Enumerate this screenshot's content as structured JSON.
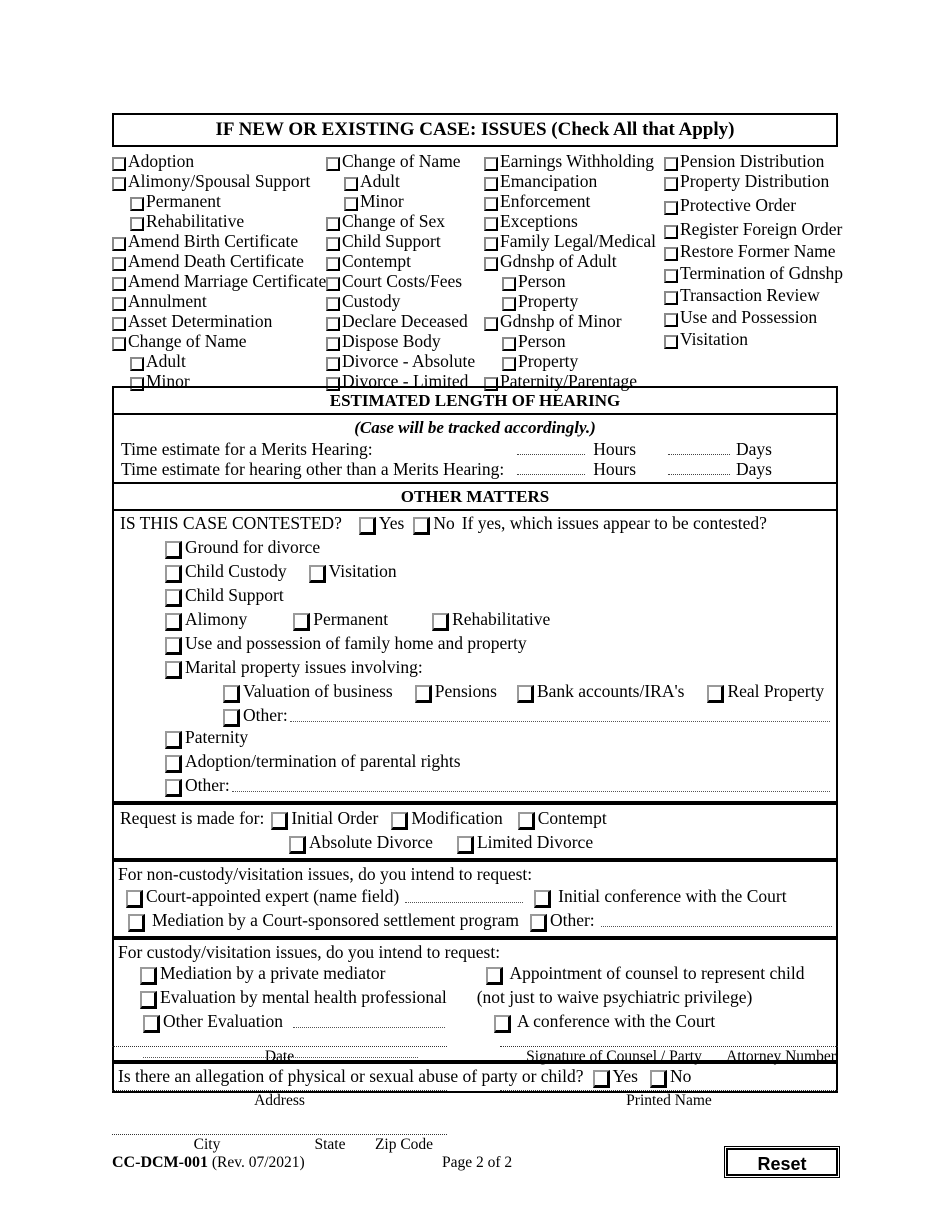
{
  "form": {
    "code": "CC-DCM-001",
    "revision": "(Rev. 07/2021)",
    "page_label": "Page 2 of 2",
    "reset_label": "Reset"
  },
  "issues_section": {
    "title": "IF NEW OR EXISTING CASE: ISSUES (Check All that Apply)",
    "columns": [
      {
        "items": [
          {
            "label": "Adoption",
            "indent": 0
          },
          {
            "label": "Alimony/Spousal Support",
            "indent": 0
          },
          {
            "label": "Permanent",
            "indent": 1
          },
          {
            "label": "Rehabilitative",
            "indent": 1
          },
          {
            "label": "Amend Birth Certificate",
            "indent": 0
          },
          {
            "label": "Amend Death Certificate",
            "indent": 0
          },
          {
            "label": "Amend Marriage Certificate",
            "indent": 0
          },
          {
            "label": "Annulment",
            "indent": 0
          },
          {
            "label": "Asset Determination",
            "indent": 0
          },
          {
            "label": "Change of Name",
            "indent": 0
          },
          {
            "label": "Adult",
            "indent": 1
          },
          {
            "label": "Minor",
            "indent": 1
          }
        ]
      },
      {
        "items": [
          {
            "label": "Change of Name",
            "indent": 0
          },
          {
            "label": "Adult",
            "indent": 1
          },
          {
            "label": "Minor",
            "indent": 1
          },
          {
            "label": "Change of Sex",
            "indent": 0
          },
          {
            "label": "Child Support",
            "indent": 0
          },
          {
            "label": "Contempt",
            "indent": 0
          },
          {
            "label": "Court Costs/Fees",
            "indent": 0
          },
          {
            "label": "Custody",
            "indent": 0
          },
          {
            "label": "Declare Deceased",
            "indent": 0
          },
          {
            "label": "Dispose Body",
            "indent": 0
          },
          {
            "label": "Divorce - Absolute",
            "indent": 0
          },
          {
            "label": "Divorce - Limited",
            "indent": 0
          }
        ]
      },
      {
        "items": [
          {
            "label": "Earnings Withholding",
            "indent": 0
          },
          {
            "label": "Emancipation",
            "indent": 0
          },
          {
            "label": "Enforcement",
            "indent": 0
          },
          {
            "label": "Exceptions",
            "indent": 0
          },
          {
            "label": "Family Legal/Medical",
            "indent": 0
          },
          {
            "label": "Gdnshp of Adult",
            "indent": 0
          },
          {
            "label": "Person",
            "indent": 1
          },
          {
            "label": "Property",
            "indent": 1
          },
          {
            "label": "Gdnshp of Minor",
            "indent": 0
          },
          {
            "label": "Person",
            "indent": 1
          },
          {
            "label": "Property",
            "indent": 1
          },
          {
            "label": "Paternity/Parentage",
            "indent": 0
          }
        ]
      },
      {
        "items": [
          {
            "label": "Pension Distribution",
            "indent": 0
          },
          {
            "label": "Property Distribution",
            "indent": 0
          },
          {
            "label": "Protective Order",
            "indent": 0
          },
          {
            "label": "Register Foreign Order",
            "indent": 0
          },
          {
            "label": "Restore Former Name",
            "indent": 0
          },
          {
            "label": "Termination of Gdnshp",
            "indent": 0
          },
          {
            "label": "Transaction Review",
            "indent": 0
          },
          {
            "label": "Use and Possession",
            "indent": 0
          },
          {
            "label": "Visitation",
            "indent": 0
          }
        ]
      }
    ]
  },
  "hearing_section": {
    "title": "ESTIMATED LENGTH OF HEARING",
    "note": "(Case will be tracked accordingly.)",
    "row1_label": "Time estimate for a Merits Hearing:",
    "row2_label": "Time estimate for hearing other than a Merits Hearing:",
    "hours_label": "Hours",
    "days_label": "Days",
    "row1_hours_value": "",
    "row1_days_value": "",
    "row2_hours_value": "",
    "row2_days_value": ""
  },
  "other_matters": {
    "title": "OTHER MATTERS",
    "contested_question": "IS THIS CASE CONTESTED?",
    "yes_label": "Yes",
    "no_label": "No",
    "contested_followup": "If yes, which issues appear to be contested?",
    "issues": {
      "ground_for_divorce": "Ground for divorce",
      "child_custody": "Child Custody",
      "visitation": "Visitation",
      "child_support": "Child Support",
      "alimony": "Alimony",
      "permanent": "Permanent",
      "rehabilitative": "Rehabilitative",
      "use_and_possession": "Use and possession of family home and property",
      "marital_property": "Marital property issues involving:",
      "valuation_of_business": "Valuation of business",
      "pensions": "Pensions",
      "bank_accounts": "Bank accounts/IRA's",
      "real_property": "Real Property",
      "other_marital": "Other:",
      "other_marital_value": "",
      "paternity": "Paternity",
      "adoption_termination": "Adoption/termination of parental rights",
      "other": "Other:",
      "other_value": ""
    }
  },
  "request_section": {
    "intro": "Request is made for:",
    "initial_order": "Initial Order",
    "modification": "Modification",
    "contempt": "Contempt",
    "absolute_divorce": "Absolute Divorce",
    "limited_divorce": "Limited Divorce"
  },
  "non_custody_section": {
    "intro": "For non-custody/visitation issues, do you intend to request:",
    "court_appointed_expert": "Court-appointed expert (name field)",
    "court_appointed_expert_value": "",
    "initial_conference": "Initial conference with the Court",
    "mediation_court_sponsored": "Mediation by a Court-sponsored settlement program",
    "other": "Other:",
    "other_value": ""
  },
  "custody_section": {
    "intro": "For custody/visitation issues, do you intend to request:",
    "private_mediator": "Mediation by a private mediator",
    "mental_health_evaluation": "Evaluation by mental health professional",
    "other_evaluation": "Other Evaluation",
    "other_evaluation_value": "",
    "other_evaluation_value2": "",
    "appointment_of_counsel": "Appointment of counsel to represent child",
    "appointment_note": "(not just to waive psychiatric privilege)",
    "conference_with_court": "A conference with the Court"
  },
  "abuse_section": {
    "question": "Is there an allegation of physical or sexual abuse of party or child?",
    "yes_label": "Yes",
    "no_label": "No"
  },
  "signature_section": {
    "date_caption": "Date",
    "date_value": "",
    "signature_caption": "Signature of Counsel / Party",
    "signature_value": "",
    "attorney_number_caption": "Attorney Number",
    "attorney_number_value": "",
    "address_caption": "Address",
    "address_value": "",
    "printed_name_caption": "Printed Name",
    "printed_name_value": "",
    "city_caption": "City",
    "state_caption": "State",
    "zip_caption": "Zip Code",
    "city_value": ""
  }
}
